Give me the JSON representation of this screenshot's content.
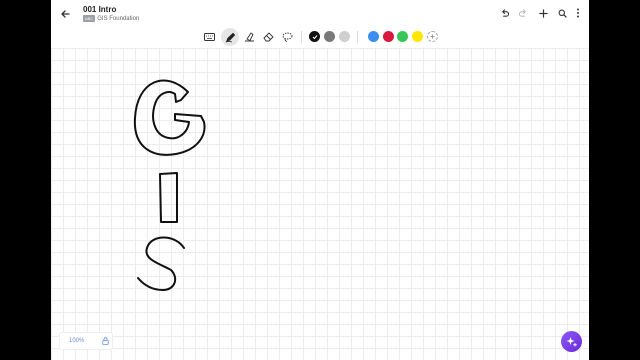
{
  "header": {
    "title": "001 Intro",
    "badge": "ABC",
    "notebook": "GIS Foundation"
  },
  "icons": {
    "back": "arrow-left-icon",
    "undo": "undo-icon",
    "redo": "redo-icon",
    "add": "plus-icon",
    "search": "search-icon",
    "more": "more-vertical-icon",
    "keyboard": "keyboard-icon",
    "pen": "pen-icon",
    "highlighter": "highlighter-icon",
    "eraser": "eraser-icon",
    "lasso": "lasso-icon",
    "lock": "lock-icon",
    "ai": "sparkle-add-icon"
  },
  "colors": {
    "pen_colors": [
      "#111111",
      "#7a7a7a",
      "#cfcfcf",
      "#3b8ef0",
      "#d7193f",
      "#36c759",
      "#ffe600"
    ],
    "selected_pen_color": "#111111",
    "accent": "#7c3aed"
  },
  "zoom": {
    "label": "100%"
  }
}
